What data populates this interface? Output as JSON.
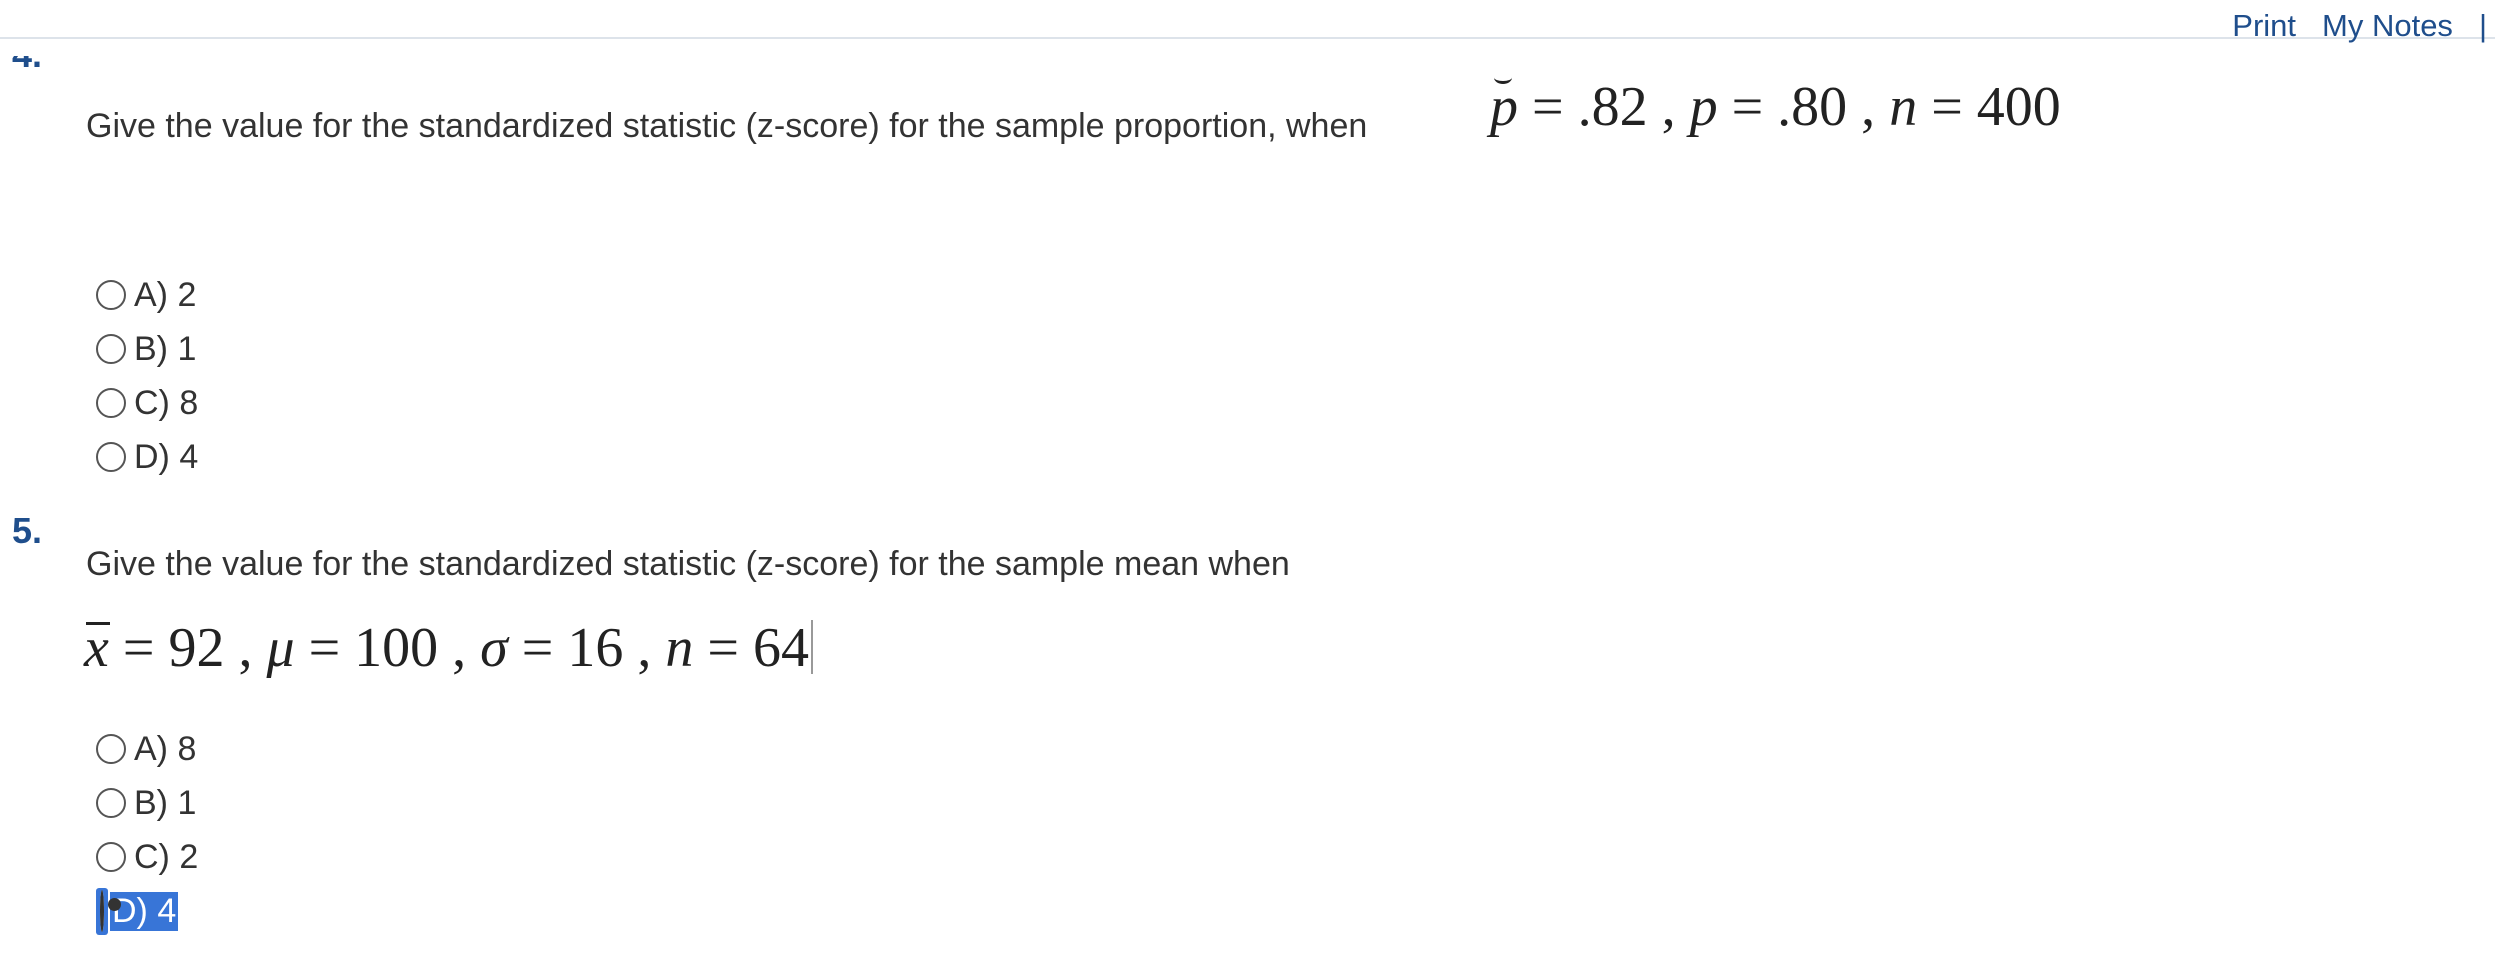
{
  "toolbar": {
    "print_label": "Print",
    "notes_label": "My Notes",
    "separator": "|"
  },
  "questions": [
    {
      "number": "4.",
      "text": "Give the value for the standardized statistic (z-score) for the sample proportion, when",
      "math": {
        "phat": "p",
        "eq1": " = .82 , ",
        "p": "p",
        "eq2": " = .80 , ",
        "n": "n",
        "eq3": " = 400"
      },
      "options": [
        {
          "label": "A) 2",
          "selected": false
        },
        {
          "label": "B) 1",
          "selected": false
        },
        {
          "label": "C) 8",
          "selected": false
        },
        {
          "label": "D) 4",
          "selected": false
        }
      ]
    },
    {
      "number": "5.",
      "text": "Give the value for the standardized statistic (z-score) for the sample mean when",
      "math": {
        "xbar": "x",
        "eq1": " = 92 , ",
        "mu": "μ",
        "eq2": " = 100 , ",
        "sigma": "σ",
        "eq3": " = 16 , ",
        "n": "n",
        "eq4": " = 64"
      },
      "options": [
        {
          "label": "A) 8",
          "selected": false
        },
        {
          "label": "B) 1",
          "selected": false
        },
        {
          "label": "C) 2",
          "selected": false
        },
        {
          "label": "D) 4",
          "selected": true
        }
      ]
    }
  ]
}
